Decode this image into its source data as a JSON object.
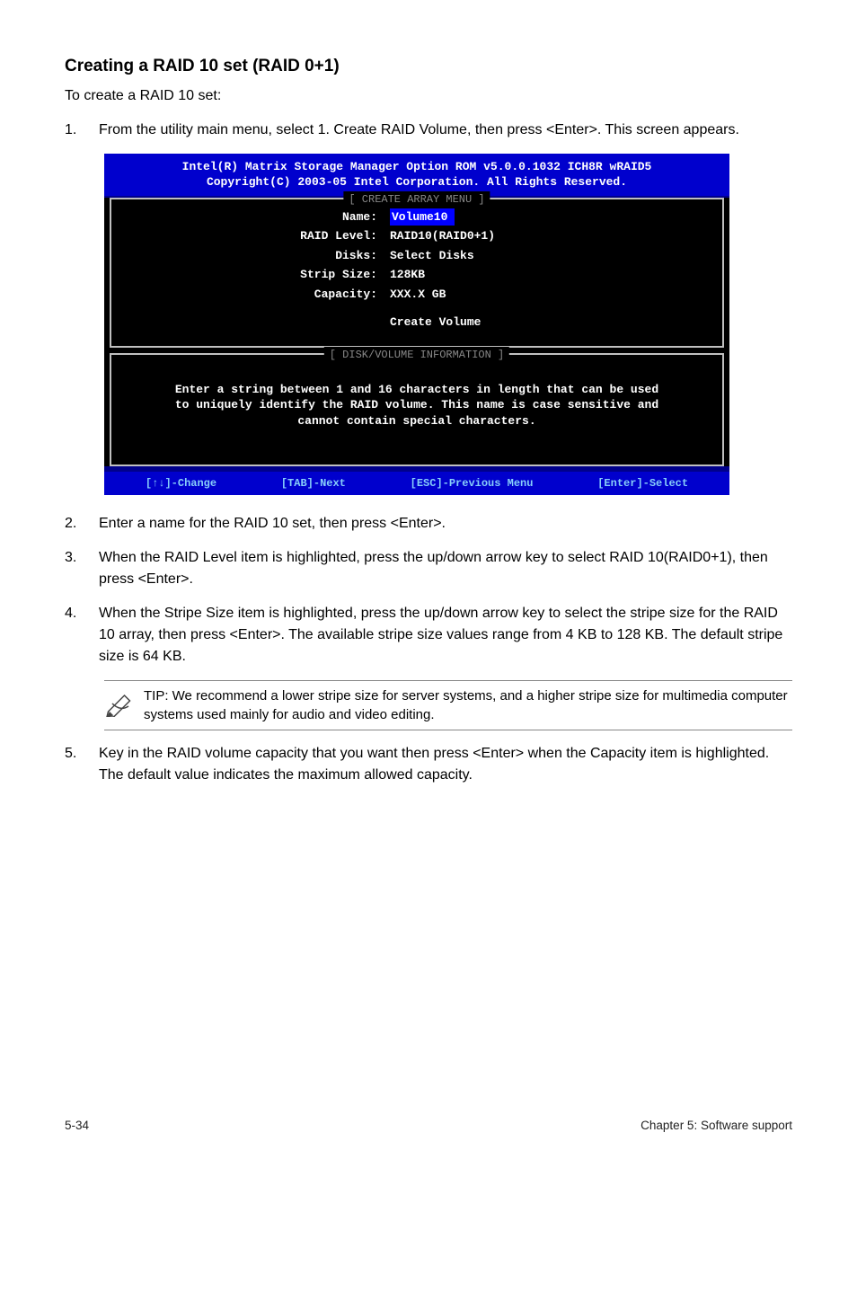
{
  "heading": "Creating a RAID 10 set (RAID 0+1)",
  "intro": "To create a RAID 10 set:",
  "steps": {
    "s1": {
      "num": "1.",
      "text": "From the utility main menu, select 1. Create RAID Volume, then press <Enter>. This screen appears."
    },
    "s2": {
      "num": "2.",
      "text": "Enter a name for the RAID 10 set, then press <Enter>."
    },
    "s3": {
      "num": "3.",
      "text": "When the RAID Level item is highlighted, press the up/down arrow key to select RAID 10(RAID0+1), then press <Enter>."
    },
    "s4": {
      "num": "4.",
      "text": "When the Stripe Size item is highlighted, press the up/down arrow key to select the stripe size for the RAID 10 array, then press <Enter>. The available stripe size values range from 4 KB to 128 KB. The default stripe size is 64 KB."
    },
    "s5": {
      "num": "5.",
      "text": "Key in the RAID volume capacity that you want then press <Enter> when the Capacity item is highlighted. The default value indicates the maximum allowed capacity."
    }
  },
  "tip": "TIP: We recommend a lower stripe size for server systems, and a higher stripe size for multimedia computer systems used mainly for audio and video editing.",
  "bios": {
    "header_line1": "Intel(R) Matrix Storage Manager Option ROM v5.0.0.1032 ICH8R wRAID5",
    "header_line2": "Copyright(C) 2003-05 Intel Corporation. All Rights Reserved.",
    "create_panel_title": "[ CREATE ARRAY MENU ]",
    "info_panel_title": "[ DISK/VOLUME INFORMATION ]",
    "fields": {
      "name": {
        "label": "Name:",
        "value": "Volume10"
      },
      "raidlevel": {
        "label": "RAID Level:",
        "value": "RAID10(RAID0+1)"
      },
      "disks": {
        "label": "Disks:",
        "value": "Select Disks"
      },
      "stripsize": {
        "label": "Strip Size:",
        "value": "128KB"
      },
      "capacity": {
        "label": "Capacity:",
        "value": "XXX.X GB"
      }
    },
    "create_volume": "Create Volume",
    "info_text_l1": "Enter a string between 1 and 16 characters in length that can be used",
    "info_text_l2": "to uniquely identify the RAID volume. This name is case sensitive and",
    "info_text_l3": "cannot contain special characters.",
    "footer": {
      "change": "[↑↓]-Change",
      "next": "[TAB]-Next",
      "prev": "[ESC]-Previous Menu",
      "select": "[Enter]-Select"
    }
  },
  "page_footer": {
    "left": "5-34",
    "right": "Chapter 5: Software support"
  }
}
